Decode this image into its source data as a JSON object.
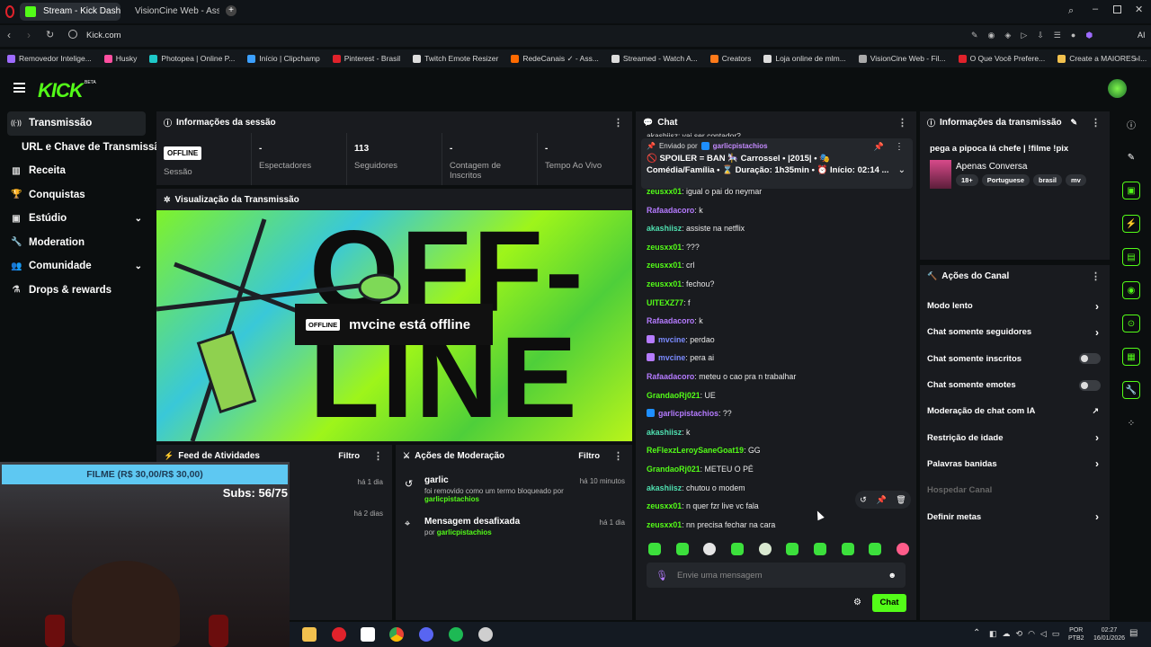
{
  "browser": {
    "tabs": [
      {
        "label": "Stream - Kick Dashboard",
        "active": true
      },
      {
        "label": "VisionCine Web - Assistir",
        "active": false
      }
    ],
    "url": "Kick.com",
    "url_right_label": "AI",
    "bookmarks": [
      "Removedor Intelige...",
      "Husky",
      "Photopea | Online P...",
      "Início | Clipchamp",
      "Pinterest - Brasil",
      "Twitch Emote Resizer",
      "RedeCanais ✓ - Ass...",
      "Streamed - Watch A...",
      "Creators",
      "Loja online de mlm...",
      "VisionCine Web - Fil...",
      "O Que Você Prefere...",
      "Create a MAIORES I..."
    ]
  },
  "header": {
    "logo": "KICK",
    "logo_badge": "BETA"
  },
  "sidebar": {
    "items": [
      {
        "label": "Transmissão",
        "icon": "broadcast-icon"
      },
      {
        "label": "URL e Chave de Transmissão",
        "icon": ""
      },
      {
        "label": "Receita",
        "icon": "revenue-icon"
      },
      {
        "label": "Conquistas",
        "icon": "trophy-icon"
      },
      {
        "label": "Estúdio",
        "icon": "studio-icon"
      },
      {
        "label": "Moderation",
        "icon": "wrench-icon"
      },
      {
        "label": "Comunidade",
        "icon": "community-icon"
      },
      {
        "label": "Drops & rewards",
        "icon": "drops-icon"
      }
    ]
  },
  "session": {
    "title": "Informações da sessão",
    "stats": [
      {
        "value": "OFFLINE",
        "label": "Sessão"
      },
      {
        "value": "-",
        "label": "Espectadores"
      },
      {
        "value": "113",
        "label": "Seguidores"
      },
      {
        "value": "-",
        "label": "Contagem de Inscritos"
      },
      {
        "value": "-",
        "label": "Tempo Ao Vivo"
      }
    ]
  },
  "preview": {
    "title": "Visualização da Transmissão",
    "badge": "OFFLINE",
    "message": "mvcine está offline",
    "bg_text": "OFF-\nLINE"
  },
  "activity": {
    "title": "Feed de Atividades",
    "filter": "Filtro",
    "rows": [
      {
        "time": "há 1 dia"
      },
      {
        "time": "há 2 dias"
      }
    ]
  },
  "moderation": {
    "title": "Ações de Moderação",
    "filter": "Filtro",
    "items": [
      {
        "title": "garlic",
        "time": "há 10 minutos",
        "desc": "foi removido como um termo bloqueado por",
        "by": "garlicpistachios"
      },
      {
        "title": "Mensagem desafixada",
        "time": "há 1 dia",
        "desc": "por",
        "by": "garlicpistachios"
      }
    ]
  },
  "overlay": {
    "banner": "FILME (R$ 30,00/R$ 30,00)",
    "subs": "Subs: 56/75"
  },
  "chat": {
    "title": "Chat",
    "cut_line": "akashiisz: vai ser contador?",
    "pinned": {
      "prefix": "Enviado por",
      "user": "garlicpistachios",
      "text": "🚫 SPOILER = BAN 🎠 Carrossel • |2015| • 🎭 Comédia/Família • ⌛ Duração: 1h35min • ⏰ Início: 02:14 ..."
    },
    "messages": [
      {
        "user": "zeusxx01",
        "color": "#53fc18",
        "text": "igual o pai do neymar"
      },
      {
        "user": "Rafaadacoro",
        "color": "#b57bff",
        "text": "k"
      },
      {
        "user": "akashiisz",
        "color": "#4fe0b0",
        "text": "assiste na netflix"
      },
      {
        "user": "zeusxx01",
        "color": "#53fc18",
        "text": "???"
      },
      {
        "user": "zeusxx01",
        "color": "#53fc18",
        "text": "crl"
      },
      {
        "user": "zeusxx01",
        "color": "#53fc18",
        "text": "fechou?"
      },
      {
        "user": "UITEXZ77",
        "color": "#53fc18",
        "text": "f"
      },
      {
        "user": "Rafaadacoro",
        "color": "#b57bff",
        "text": "k"
      },
      {
        "user": "mvcine",
        "color": "#7b8bff",
        "text": "perdao",
        "badge": "mic"
      },
      {
        "user": "mvcine",
        "color": "#7b8bff",
        "text": "pera ai",
        "badge": "mic"
      },
      {
        "user": "Rafaadacoro",
        "color": "#b57bff",
        "text": "meteu o cao pra n trabalhar"
      },
      {
        "user": "GrandaoRj021",
        "color": "#53fc18",
        "text": "UE"
      },
      {
        "user": "garlicpistachios",
        "color": "#b57bff",
        "text": "??",
        "badge": "mod"
      },
      {
        "user": "akashiisz",
        "color": "#4fe0b0",
        "text": "k"
      },
      {
        "user": "ReFlexzLeroySaneGoat19",
        "color": "#53fc18",
        "text": "GG"
      },
      {
        "user": "GrandaoRj021",
        "color": "#53fc18",
        "text": "METEU O PÉ"
      },
      {
        "user": "akashiisz",
        "color": "#4fe0b0",
        "text": "chutou o modem"
      },
      {
        "user": "zeusxx01",
        "color": "#53fc18",
        "text": "n quer fzr live vc fala"
      },
      {
        "user": "zeusxx01",
        "color": "#53fc18",
        "text": "nn precisa fechar na cara"
      }
    ],
    "input_placeholder": "Envie uma mensagem",
    "send_label": "Chat"
  },
  "stream_info": {
    "title": "Informações da transmissão",
    "stream_title": "pega a pipoca lá chefe | !filme !pix",
    "category": "Apenas Conversa",
    "tags": [
      "18+",
      "Portuguese",
      "brasil",
      "mv"
    ]
  },
  "channel_actions": {
    "title": "Ações do Canal",
    "items": [
      {
        "label": "Modo lento",
        "control": "chevron"
      },
      {
        "label": "Chat somente seguidores",
        "control": "chevron"
      },
      {
        "label": "Chat somente inscritos",
        "control": "toggle"
      },
      {
        "label": "Chat somente emotes",
        "control": "toggle"
      },
      {
        "label": "Moderação de chat com IA",
        "control": "external"
      },
      {
        "label": "Restrição de idade",
        "control": "chevron"
      },
      {
        "label": "Palavras banidas",
        "control": "chevron"
      },
      {
        "label": "Hospedar Canal",
        "control": "none",
        "disabled": true
      },
      {
        "label": "Definir metas",
        "control": "chevron"
      }
    ]
  },
  "taskbar": {
    "lang": "POR",
    "lang2": "PTB2",
    "time": "02:27",
    "date": "16/01/2026"
  },
  "colors": {
    "accent": "#53fc18",
    "panel": "#191b1f",
    "bg": "#0b0e0f"
  }
}
